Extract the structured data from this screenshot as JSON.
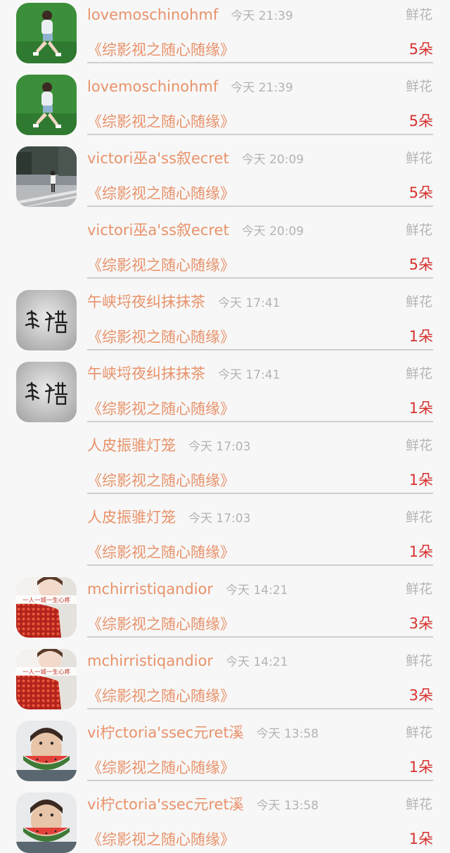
{
  "gift_label": "鲜花",
  "entries": [
    {
      "name": "lovemoschinohmf",
      "time": "今天 21:39",
      "book": "《综影视之随心随缘》",
      "count": "5朵",
      "avatar": "girl-green-avatar"
    },
    {
      "name": "lovemoschinohmf",
      "time": "今天 21:39",
      "book": "《综影视之随心随缘》",
      "count": "5朵",
      "avatar": "girl-green-avatar"
    },
    {
      "name": "victori巫a'ss叙ecret",
      "time": "今天 20:09",
      "book": "《综影视之随心随缘》",
      "count": "5朵",
      "avatar": "street-photo-avatar"
    },
    {
      "name": "victori巫a'ss叙ecret",
      "time": "今天 20:09",
      "book": "《综影视之随心随缘》",
      "count": "5朵",
      "avatar": null
    },
    {
      "name": "午峡埒夜纠抹抹茶",
      "time": "今天 17:41",
      "book": "《综影视之随心随缘》",
      "count": "1朵",
      "avatar": "calligraphy-avatar"
    },
    {
      "name": "午峡埒夜纠抹抹茶",
      "time": "今天 17:41",
      "book": "《综影视之随心随缘》",
      "count": "1朵",
      "avatar": "calligraphy-avatar"
    },
    {
      "name": "人皮振骓灯笼",
      "time": "今天 17:03",
      "book": "《综影视之随心随缘》",
      "count": "1朵",
      "avatar": null
    },
    {
      "name": "人皮振骓灯笼",
      "time": "今天 17:03",
      "book": "《综影视之随心随缘》",
      "count": "1朵",
      "avatar": null
    },
    {
      "name": "mchirristiqandior",
      "time": "今天 14:21",
      "book": "《综影视之随心随缘》",
      "count": "3朵",
      "avatar": "red-dots-avatar",
      "avatar_text": "一人一城一生心疼"
    },
    {
      "name": "mchirristiqandior",
      "time": "今天 14:21",
      "book": "《综影视之随心随缘》",
      "count": "3朵",
      "avatar": "red-dots-avatar",
      "avatar_text": "一人一城一生心疼"
    },
    {
      "name": "vi柠ctoria'ssec元ret溪",
      "time": "今天 13:58",
      "book": "《综影视之随心随缘》",
      "count": "1朵",
      "avatar": "watermelon-man-avatar"
    },
    {
      "name": "vi柠ctoria'ssec元ret溪",
      "time": "今天 13:58",
      "book": "《综影视之随心随缘》",
      "count": "1朵",
      "avatar": "watermelon-man-avatar"
    }
  ]
}
